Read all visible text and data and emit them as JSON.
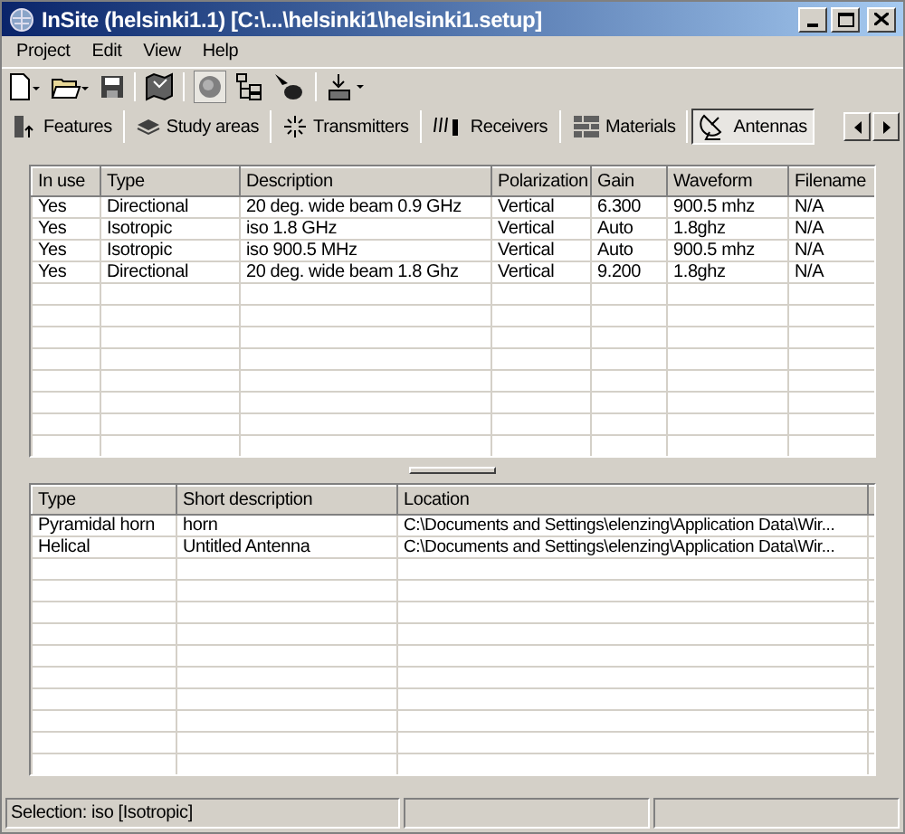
{
  "window": {
    "title": "InSite (helsinki1.1) [C:\\...\\helsinki1\\helsinki1.setup]"
  },
  "menu": [
    "Project",
    "Edit",
    "View",
    "Help"
  ],
  "tabs": [
    {
      "label": "Features",
      "selected": false
    },
    {
      "label": "Study areas",
      "selected": false
    },
    {
      "label": "Transmitters",
      "selected": false
    },
    {
      "label": "Receivers",
      "selected": false
    },
    {
      "label": "Materials",
      "selected": false
    },
    {
      "label": "Antennas",
      "selected": true
    }
  ],
  "antennas_table": {
    "columns": [
      "In use",
      "Type",
      "Description",
      "Polarization",
      "Gain",
      "Waveform",
      "Filename"
    ],
    "rows": [
      [
        "Yes",
        "Directional",
        "20 deg. wide beam 0.9 GHz",
        "Vertical",
        "6.300",
        "900.5 mhz",
        "N/A"
      ],
      [
        "Yes",
        "Isotropic",
        "iso 1.8 GHz",
        "Vertical",
        "Auto",
        "1.8ghz",
        "N/A"
      ],
      [
        "Yes",
        "Isotropic",
        "iso 900.5 MHz",
        "Vertical",
        "Auto",
        "900.5 mhz",
        "N/A"
      ],
      [
        "Yes",
        "Directional",
        "20 deg. wide beam 1.8 Ghz",
        "Vertical",
        "9.200",
        "1.8ghz",
        "N/A"
      ]
    ]
  },
  "types_table": {
    "columns": [
      "Type",
      "Short description",
      "Location"
    ],
    "rows": [
      [
        "Pyramidal horn",
        "horn",
        "C:\\Documents and Settings\\elenzing\\Application Data\\Wir..."
      ],
      [
        "Helical",
        "Untitled Antenna",
        "C:\\Documents and Settings\\elenzing\\Application Data\\Wir..."
      ]
    ]
  },
  "status_bar": "Selection: iso [Isotropic]"
}
